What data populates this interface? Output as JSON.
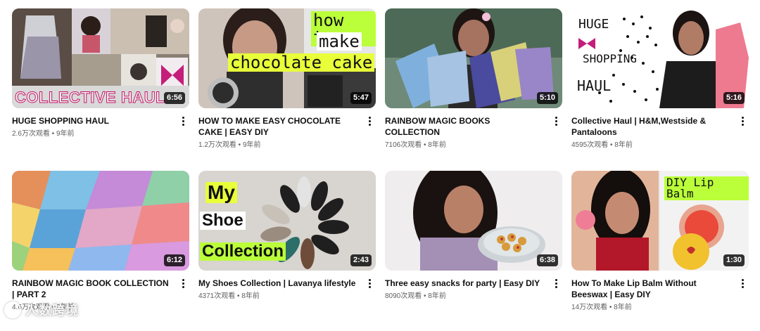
{
  "videos": [
    {
      "title": "HUGE SHOPPING HAUL",
      "stats": "2.6万次观看 • 9年前",
      "duration": "6:56",
      "overlay": [
        "COLLECTIVE HAUL"
      ]
    },
    {
      "title": "HOW TO MAKE EASY CHOCOLATE CAKE | EASY DIY",
      "stats": "1.2万次观看 • 9年前",
      "duration": "5:47",
      "overlay": [
        "how to",
        "make",
        "chocolate cake"
      ]
    },
    {
      "title": "RAINBOW MAGIC BOOKS COLLECTION",
      "stats": "7106次观看 • 8年前",
      "duration": "5:10",
      "overlay": []
    },
    {
      "title": "Collective Haul | H&M,Westside & Pantaloons",
      "stats": "4595次观看 • 8年前",
      "duration": "5:16",
      "overlay": [
        "HUGE",
        "SHOPPING",
        "HAUL"
      ]
    },
    {
      "title": "RAINBOW MAGIC BOOK COLLECTION | PART 2",
      "stats": "4.6万次观看 • 8年前",
      "duration": "6:12",
      "overlay": []
    },
    {
      "title": "My Shoes Collection | Lavanya lifestyle",
      "stats": "4371次观看 • 8年前",
      "duration": "2:43",
      "overlay": [
        "My",
        "Shoe",
        "Collection"
      ]
    },
    {
      "title": "Three easy snacks for party | Easy DIY",
      "stats": "8090次观看 • 8年前",
      "duration": "6:38",
      "overlay": []
    },
    {
      "title": "How To Make Lip Balm Without Beeswax | Easy DIY",
      "stats": "14万次观看 • 8年前",
      "duration": "1:30",
      "overlay": [
        "DIY Lip Balm"
      ]
    }
  ],
  "watermark": "人数跨境",
  "colors": {
    "accent_yellow": "#e8ff3a",
    "accent_green": "#baff3a",
    "duration_bg": "#000000"
  }
}
